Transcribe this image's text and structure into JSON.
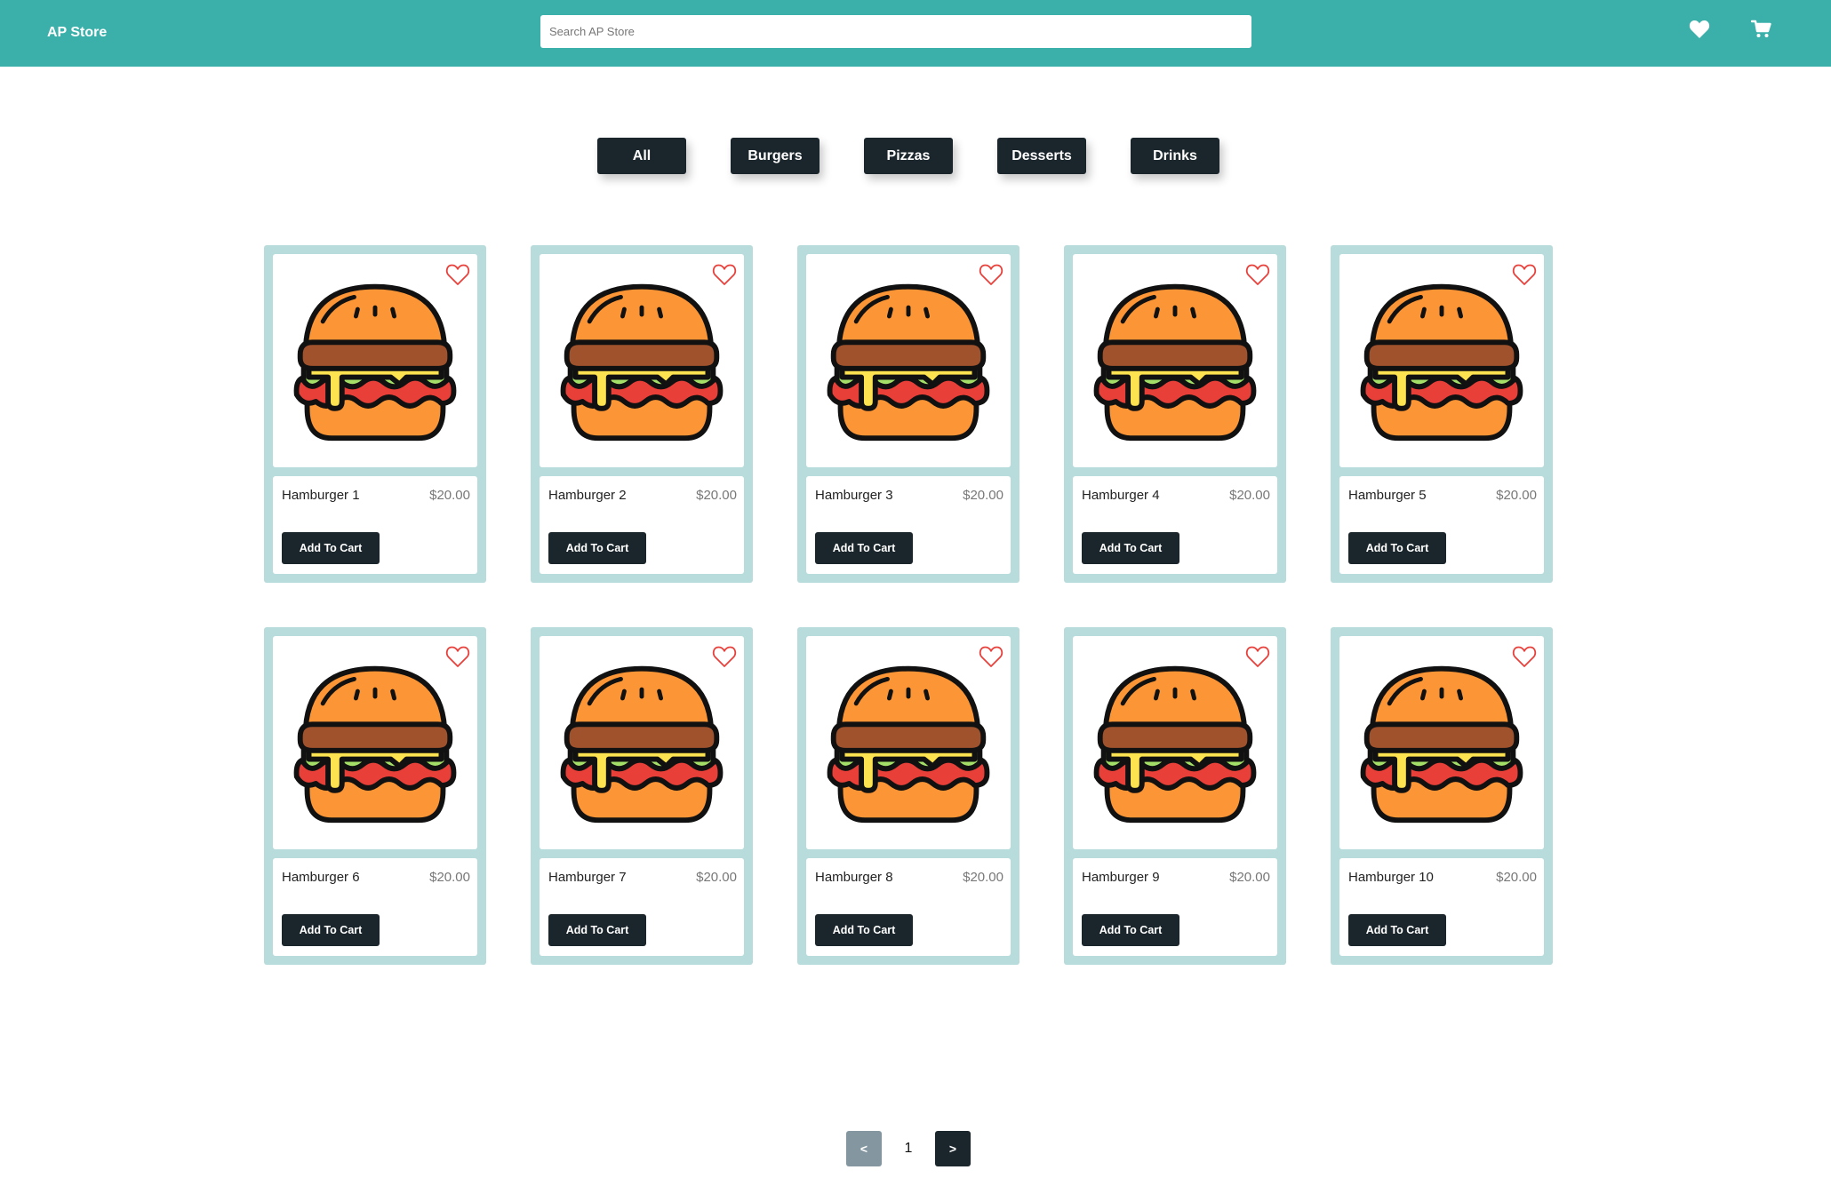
{
  "header": {
    "brand": "AP Store",
    "search_placeholder": "Search AP Store",
    "wishlist_icon": "heart-icon",
    "cart_icon": "cart-icon",
    "bar_color": "#3bb0aa"
  },
  "categories": [
    "All",
    "Burgers",
    "Pizzas",
    "Desserts",
    "Drinks"
  ],
  "products": [
    {
      "name": "Hamburger 1",
      "price": "$20.00",
      "button": "Add To Cart"
    },
    {
      "name": "Hamburger 2",
      "price": "$20.00",
      "button": "Add To Cart"
    },
    {
      "name": "Hamburger 3",
      "price": "$20.00",
      "button": "Add To Cart"
    },
    {
      "name": "Hamburger 4",
      "price": "$20.00",
      "button": "Add To Cart"
    },
    {
      "name": "Hamburger 5",
      "price": "$20.00",
      "button": "Add To Cart"
    },
    {
      "name": "Hamburger 6",
      "price": "$20.00",
      "button": "Add To Cart"
    },
    {
      "name": "Hamburger 7",
      "price": "$20.00",
      "button": "Add To Cart"
    },
    {
      "name": "Hamburger 8",
      "price": "$20.00",
      "button": "Add To Cart"
    },
    {
      "name": "Hamburger 9",
      "price": "$20.00",
      "button": "Add To Cart"
    },
    {
      "name": "Hamburger 10",
      "price": "$20.00",
      "button": "Add To Cart"
    }
  ],
  "product_image_icon": "hamburger-icon",
  "favorite_icon": "heart-outline-icon",
  "pagination": {
    "prev": "<",
    "current": "1",
    "next": ">"
  },
  "colors": {
    "accent": "#3bb0aa",
    "dark_button": "#1b262c",
    "card_frame": "#b8dcdc",
    "favorite": "#e8413c",
    "disabled_button": "#8497a0"
  }
}
